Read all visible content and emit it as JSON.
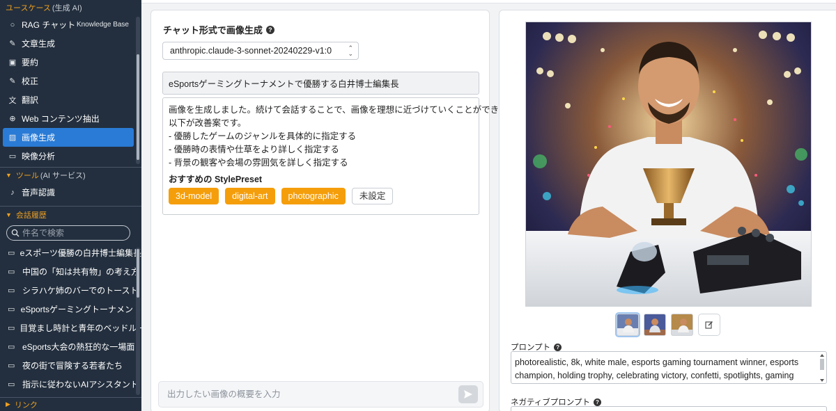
{
  "sidebar": {
    "use_case_header": {
      "title": "ユースケース",
      "sub": "(生成 AI)"
    },
    "use_case_items": [
      {
        "label": "RAG チャット",
        "icon": "chat-bubble-icon",
        "glyph": "○",
        "extra": "Knowledge Base"
      },
      {
        "label": "文章生成",
        "icon": "pencil-icon",
        "glyph": "✎"
      },
      {
        "label": "要約",
        "icon": "summary-icon",
        "glyph": "▣"
      },
      {
        "label": "校正",
        "icon": "edit-check-icon",
        "glyph": "✎"
      },
      {
        "label": "翻訳",
        "icon": "translate-icon",
        "glyph": "文"
      },
      {
        "label": "Web コンテンツ抽出",
        "icon": "globe-icon",
        "glyph": "⊕"
      },
      {
        "label": "画像生成",
        "icon": "image-icon",
        "glyph": "▨",
        "active": true
      },
      {
        "label": "映像分析",
        "icon": "video-icon",
        "glyph": "▭"
      }
    ],
    "tools_header": {
      "title": "ツール",
      "sub": "(AI サービス)"
    },
    "tools_items": [
      {
        "label": "音声認識",
        "icon": "speaker-icon",
        "glyph": "♪"
      }
    ],
    "history_header": {
      "title": "会話履歴"
    },
    "search": {
      "placeholder": "件名で検索"
    },
    "history_items": [
      "eスポーツ優勝の白井博士編集長",
      "中国の「知は共有物」の考え方",
      "シラハケ姉のバーでのトースト",
      "eSportsゲーミングトーナメント",
      "目覚まし時計と青年のベッドルーム",
      "eSports大会の熱狂的な一場面",
      "夜の街で冒険する若者たち",
      "指示に従わないAIアシスタント"
    ],
    "link_header": {
      "title": "リンク"
    }
  },
  "chat": {
    "title": "チャット形式で画像生成",
    "model": "anthropic.claude-3-sonnet-20240229-v1:0",
    "user_message": "eSportsゲーミングトーナメントで優勝する白井博士編集長",
    "bot_lines": [
      "画像を生成しました。続けて会話することで、画像を理想に近づけていくことができます。",
      "以下が改善案です。",
      "- 優勝したゲームのジャンルを具体的に指定する",
      "- 優勝時の表情や仕草をより詳しく指定する",
      "- 背景の観客や会場の雰囲気を詳しく指定する"
    ],
    "preset_title": "おすすめの StylePreset",
    "presets": [
      "3d-model",
      "digital-art",
      "photographic",
      "未設定"
    ],
    "input_placeholder": "出力したい画像の概要を入力"
  },
  "image_panel": {
    "prompt_label": "プロンプト",
    "prompt_text": "photorealistic, 8k, white male, esports gaming tournament winner, esports champion, holding trophy, celebrating victory, confetti, spotlights, gaming",
    "negative_label": "ネガティブプロンプト"
  },
  "colors": {
    "sidebar_bg": "#232f3e",
    "active_item": "#2a7bd5",
    "accent_orange": "#f59e0b",
    "header_orange": "#f0a020"
  }
}
